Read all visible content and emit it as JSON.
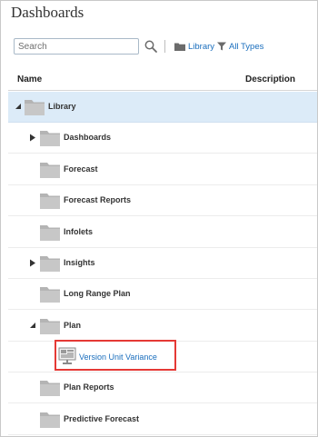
{
  "page": {
    "title": "Dashboards"
  },
  "toolbar": {
    "search_placeholder": "Search",
    "library_label": "Library",
    "filter_label": "All Types"
  },
  "table": {
    "columns": [
      "Name",
      "Description"
    ]
  },
  "tree": {
    "items": [
      {
        "label": "Library",
        "level": 0,
        "expander": "expanded",
        "type": "folder",
        "selected": true
      },
      {
        "label": "Dashboards",
        "level": 1,
        "expander": "collapsed",
        "type": "folder"
      },
      {
        "label": "Forecast",
        "level": 1,
        "expander": "none",
        "type": "folder"
      },
      {
        "label": "Forecast Reports",
        "level": 1,
        "expander": "none",
        "type": "folder"
      },
      {
        "label": "Infolets",
        "level": 1,
        "expander": "none",
        "type": "folder"
      },
      {
        "label": "Insights",
        "level": 1,
        "expander": "collapsed",
        "type": "folder"
      },
      {
        "label": "Long Range Plan",
        "level": 1,
        "expander": "none",
        "type": "folder"
      },
      {
        "label": "Plan",
        "level": 1,
        "expander": "expanded",
        "type": "folder"
      },
      {
        "label": "Version Unit Variance",
        "level": 2,
        "expander": "none",
        "type": "dashboard",
        "highlighted": true
      },
      {
        "label": "Plan Reports",
        "level": 1,
        "expander": "none",
        "type": "folder"
      },
      {
        "label": "Predictive Forecast",
        "level": 1,
        "expander": "none",
        "type": "folder"
      }
    ]
  },
  "colors": {
    "link": "#1a6ebd",
    "selected_row": "#dcebf8",
    "highlight_border": "#e53935",
    "folder": "#b4b4b4"
  }
}
